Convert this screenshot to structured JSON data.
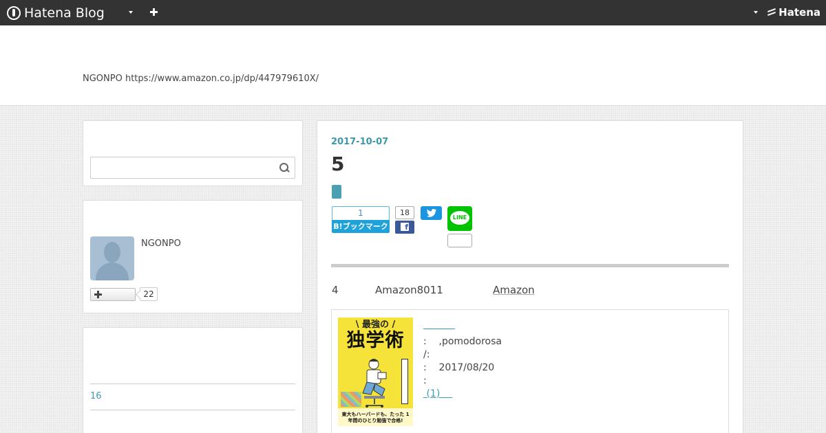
{
  "topbar": {
    "logo_text": "Hatena Blog",
    "right_logo_text": "Hatena"
  },
  "header": {
    "description": "NGONPO https://www.amazon.co.jp/dp/447979610X/"
  },
  "sidebar": {
    "search": {
      "placeholder": ""
    },
    "profile": {
      "name": "NGONPO",
      "follow_count": "22"
    },
    "archive": {
      "link_text": "16"
    }
  },
  "article": {
    "date": "2017-10-07",
    "title": "5",
    "share": {
      "hatena_count": "1",
      "hatena_label": "B!ブックマーク",
      "facebook_count": "18",
      "facebook_icon": "f",
      "line_label": "LINE"
    },
    "body": {
      "part1": "4",
      "part2": "Amazon8011",
      "link": "Amazon"
    },
    "product": {
      "book": {
        "banner": "\\ 最強の /",
        "title": "独学術",
        "footer": "東大もハーバードも、たった 1年間のひとり勉強で合格!"
      },
      "line1": ":    ,pomodorosa",
      "line2": "/:",
      "line3": ":    2017/08/20",
      "line4": ":",
      "review_link": " (1)    "
    }
  },
  "colors": {
    "topbar": "#333333",
    "accent": "#3d97ab",
    "hatena": "#1fa2d9",
    "facebook": "#3b5998",
    "twitter": "#1b95e0",
    "line": "#00c300"
  }
}
